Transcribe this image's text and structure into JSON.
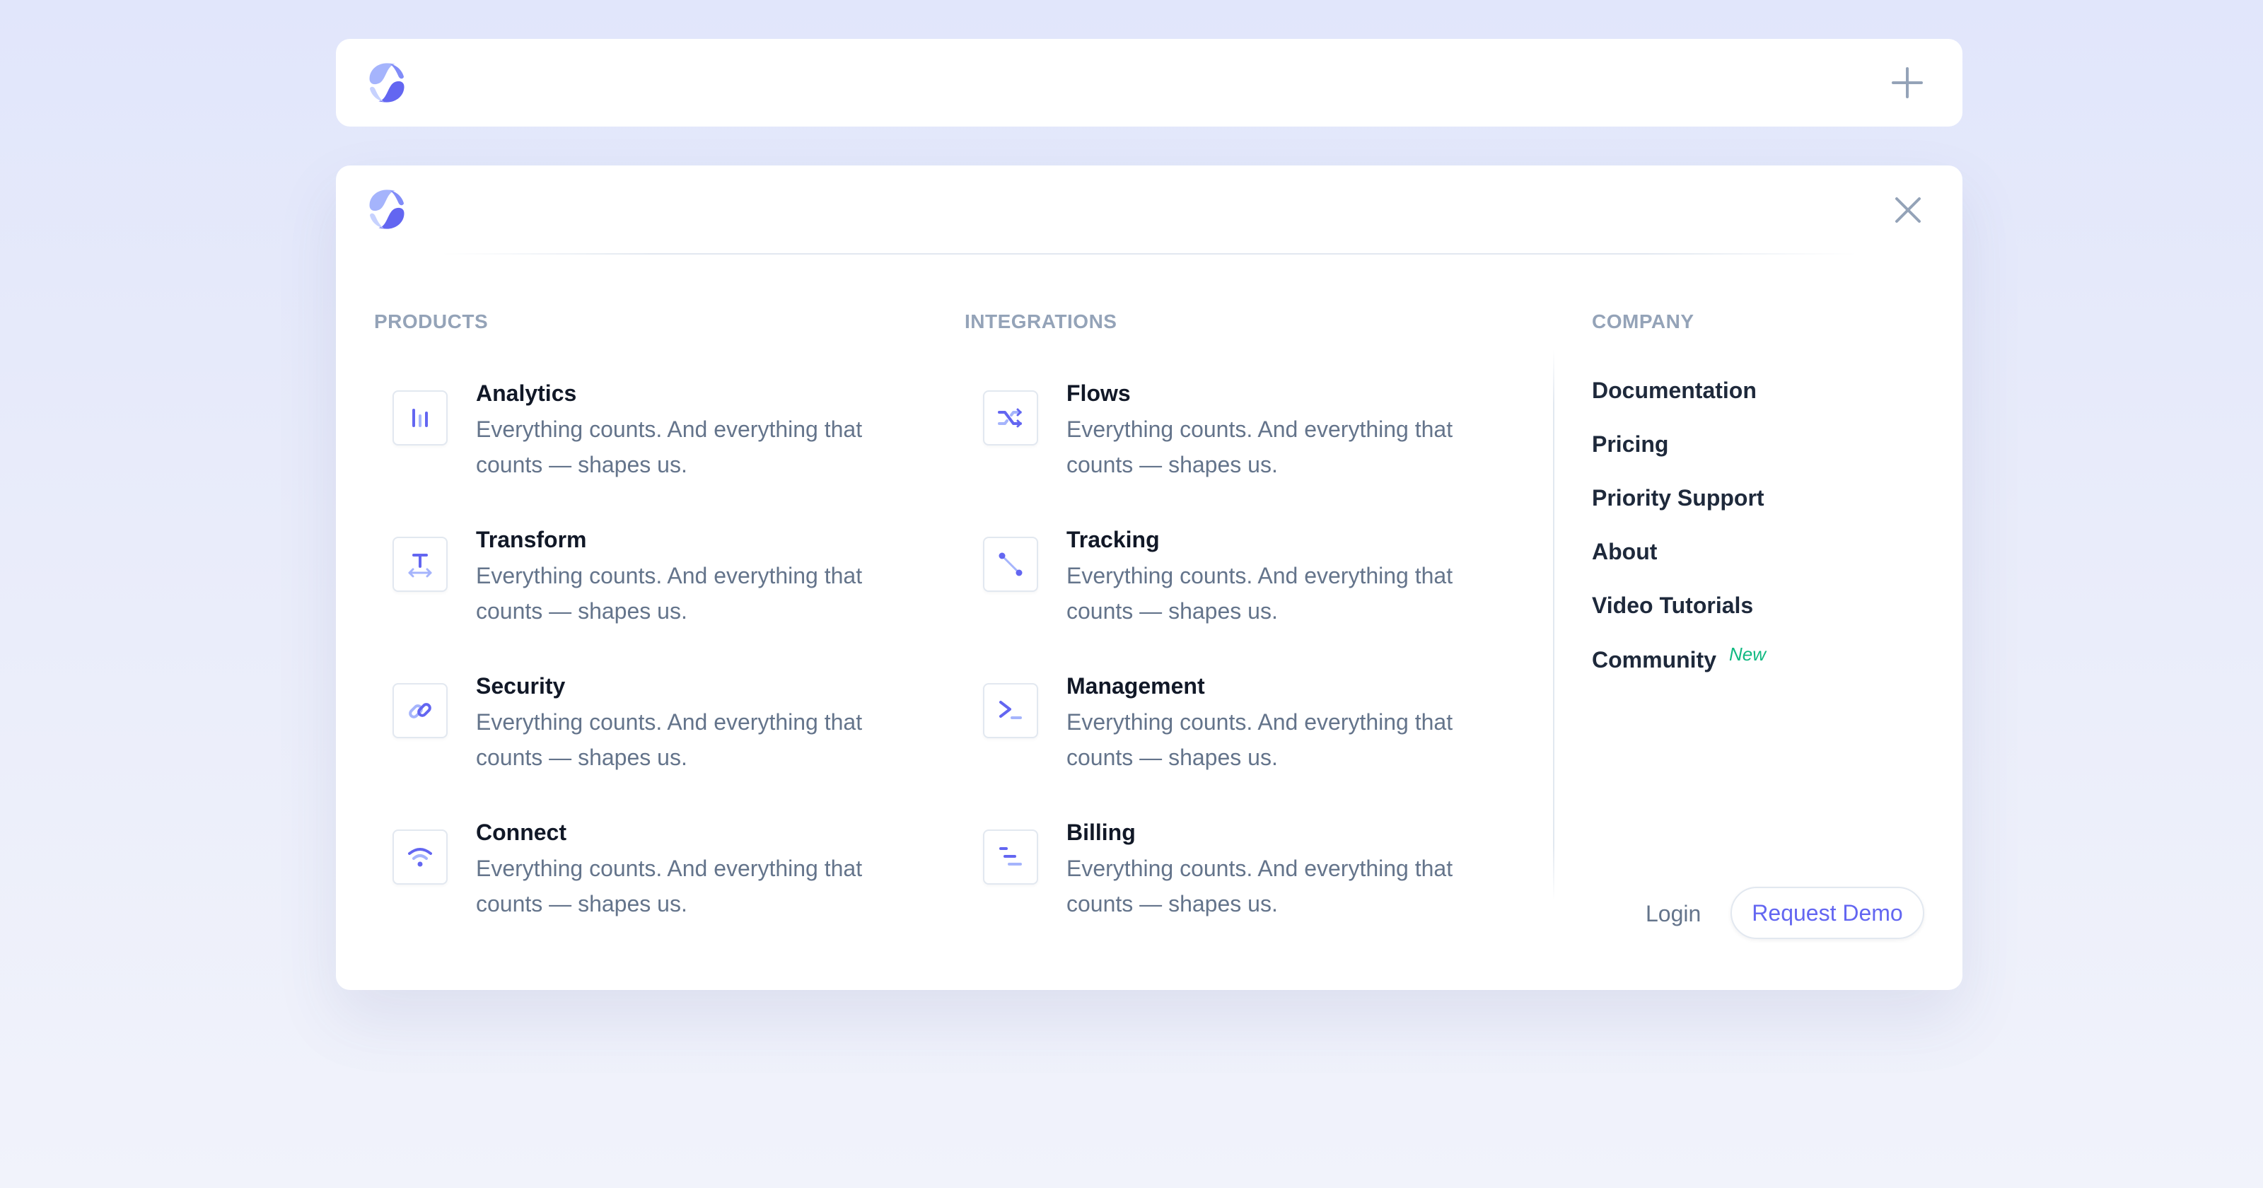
{
  "topbar": {
    "logo": "brand-logo",
    "toggle_icon": "plus-icon"
  },
  "menu": {
    "close_icon": "close-icon",
    "columns": {
      "products": {
        "heading": "PRODUCTS",
        "items": [
          {
            "title": "Analytics",
            "description": "Everything counts. And everything that counts — shapes us.",
            "icon": "bar-chart-icon"
          },
          {
            "title": "Transform",
            "description": "Everything counts. And everything that counts — shapes us.",
            "icon": "text-resize-icon"
          },
          {
            "title": "Security",
            "description": "Everything counts. And everything that counts — shapes us.",
            "icon": "link-icon"
          },
          {
            "title": "Connect",
            "description": "Everything counts. And everything that counts — shapes us.",
            "icon": "wifi-icon"
          }
        ]
      },
      "integrations": {
        "heading": "INTEGRATIONS",
        "items": [
          {
            "title": "Flows",
            "description": "Everything counts. And everything that counts — shapes us.",
            "icon": "shuffle-icon"
          },
          {
            "title": "Tracking",
            "description": "Everything counts. And everything that counts — shapes us.",
            "icon": "vector-line-icon"
          },
          {
            "title": "Management",
            "description": "Everything counts. And everything that counts — shapes us.",
            "icon": "terminal-icon"
          },
          {
            "title": "Billing",
            "description": "Everything counts. And everything that counts — shapes us.",
            "icon": "list-lines-icon"
          }
        ]
      },
      "company": {
        "heading": "COMPANY",
        "links": [
          "Documentation",
          "Pricing",
          "Priority Support",
          "About",
          "Video Tutorials",
          "Community"
        ],
        "new_badge": "New"
      }
    },
    "actions": {
      "login": "Login",
      "request_demo": "Request Demo"
    }
  },
  "colors": {
    "accent": "#6366f1",
    "accent_light": "#a5b4fc",
    "badge_green": "#10b981",
    "heading_gray": "#94a3b8",
    "text_dark": "#111827",
    "text_muted": "#64748b",
    "background": "#e1e6fb"
  }
}
